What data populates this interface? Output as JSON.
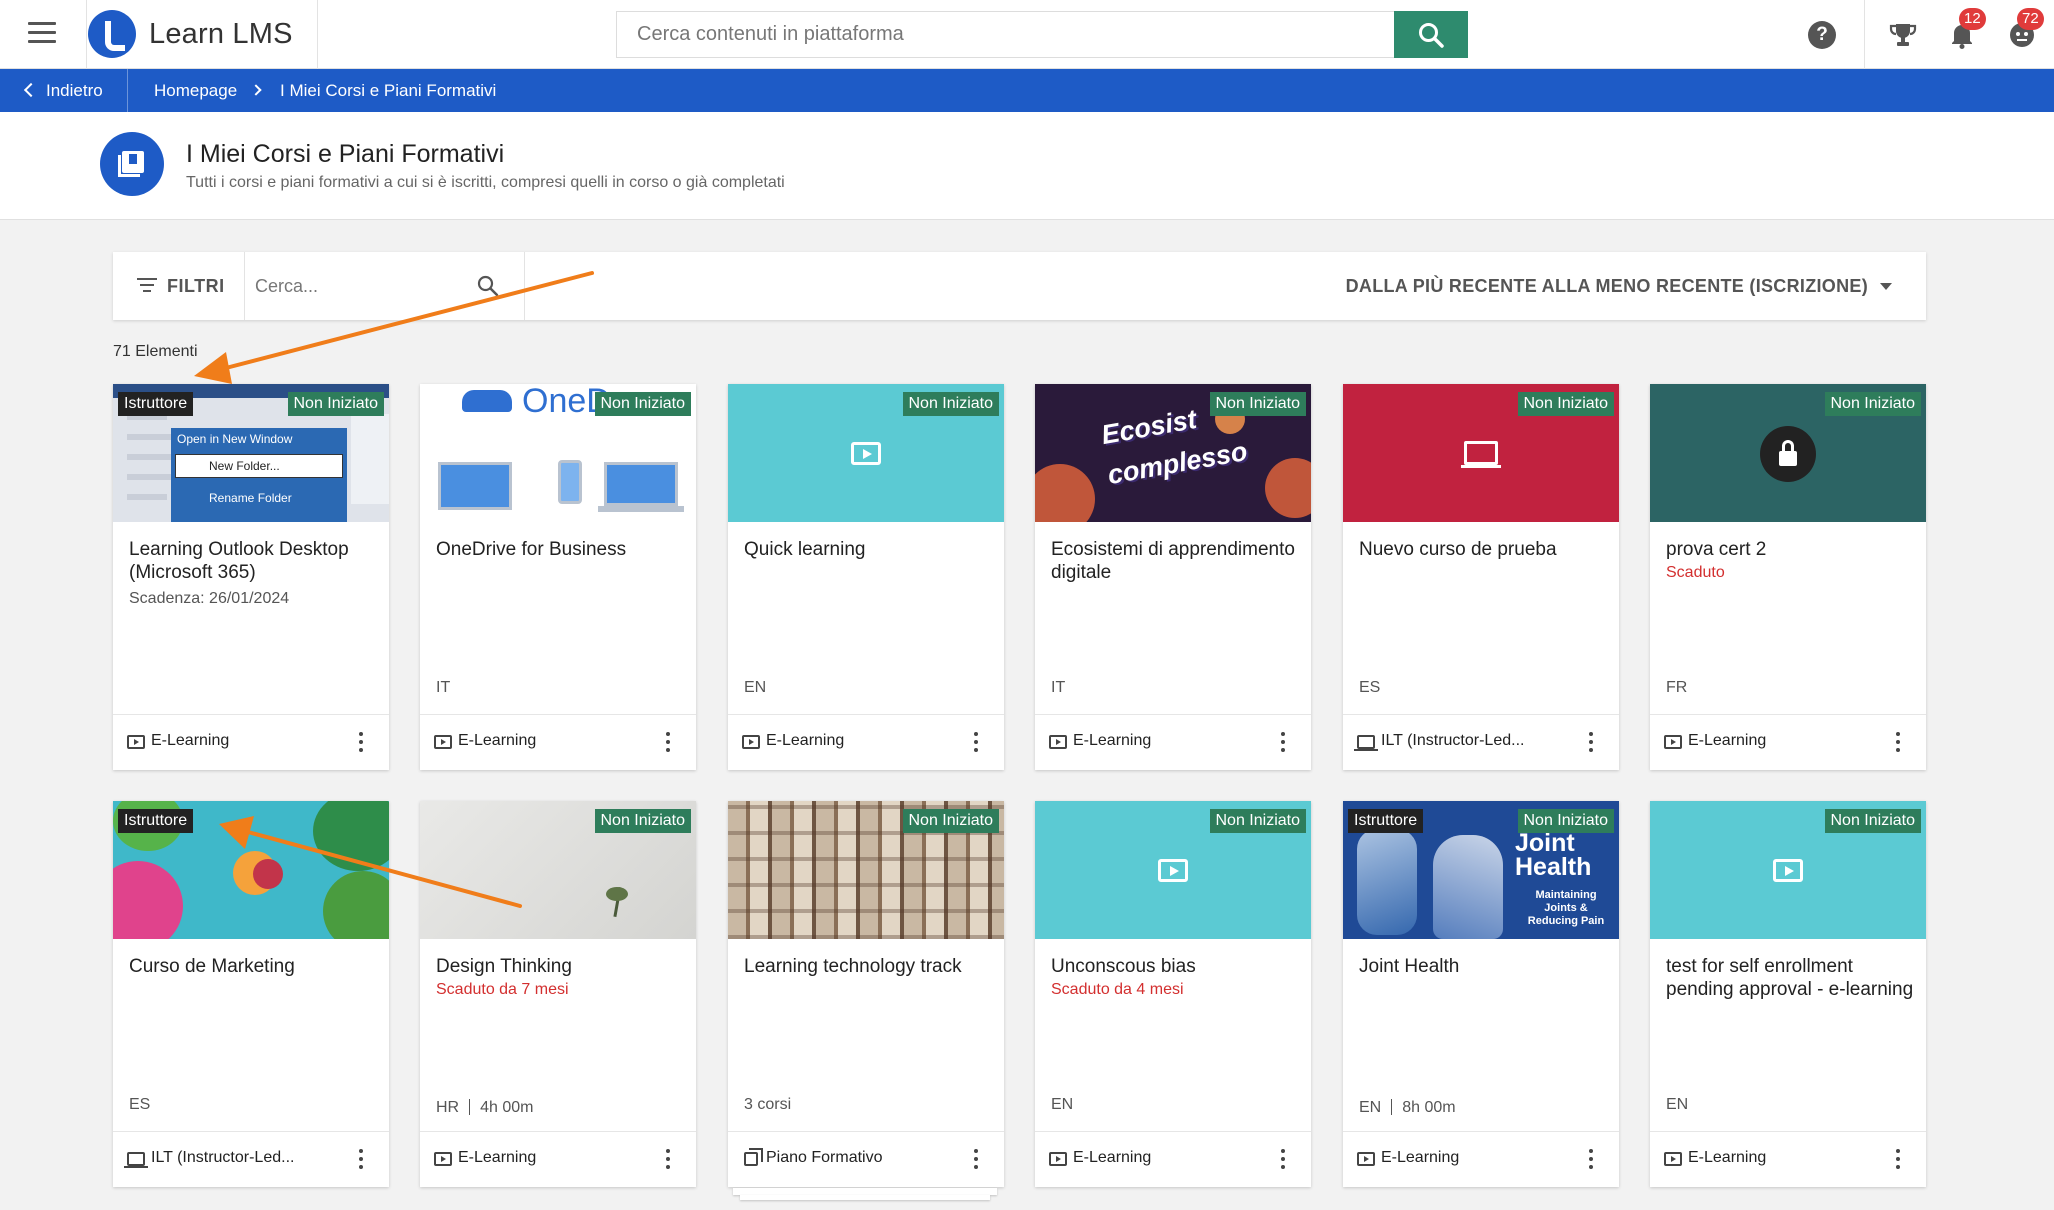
{
  "app": {
    "name": "Learn LMS",
    "search_placeholder": "Cerca contenuti in piattaforma",
    "notifications_count": "12",
    "messages_count": "72"
  },
  "breadcrumb": {
    "back_label": "Indietro",
    "home_label": "Homepage",
    "current_label": "I Miei Corsi e Piani Formativi"
  },
  "page": {
    "title": "I Miei Corsi e Piani Formativi",
    "subtitle": "Tutti i corsi e piani formativi a cui si è iscritti, compresi quelli in corso o già completati"
  },
  "filters": {
    "filter_label": "FILTRI",
    "search_placeholder": "Cerca...",
    "sort_label": "DALLA PIÙ RECENTE ALLA MENO RECENTE (ISCRIZIONE)"
  },
  "items_count": "71 Elementi",
  "thumb_texts": {
    "menu_open": "Open in New Window",
    "menu_new": "New Folder...",
    "menu_rename": "Rename Folder",
    "onedrive": "OneD",
    "ecosistemi_1": "Ecosist",
    "ecosistemi_2": "complesso",
    "joint_1": "Joint",
    "joint_2": "Health",
    "joint_3": "Maintaining",
    "joint_4": "Joints &",
    "joint_5": "Reducing Pain"
  },
  "courses": [
    {
      "title": "Learning Outlook Desktop (Microsoft 365)",
      "status": "Non Iniziato",
      "instructor_tag": "Istruttore",
      "sub": "Scadenza: 26/01/2024",
      "lang": "",
      "type": "E-Learning"
    },
    {
      "title": "OneDrive for Business",
      "status": "Non Iniziato",
      "lang": "IT",
      "type": "E-Learning"
    },
    {
      "title": "Quick learning",
      "status": "Non Iniziato",
      "lang": "EN",
      "type": "E-Learning"
    },
    {
      "title": "Ecosistemi di apprendimento digitale",
      "status": "Non Iniziato",
      "lang": "IT",
      "type": "E-Learning"
    },
    {
      "title": "Nuevo curso de prueba",
      "status": "Non Iniziato",
      "lang": "ES",
      "type": "ILT (Instructor-Led..."
    },
    {
      "title": "prova cert 2",
      "status": "Non Iniziato",
      "sub": "Scaduto",
      "lang": "FR",
      "type": "E-Learning"
    },
    {
      "title": "Curso de Marketing",
      "instructor_tag": "Istruttore",
      "lang": "ES",
      "type": "ILT (Instructor-Led..."
    },
    {
      "title": "Design Thinking",
      "status": "Non Iniziato",
      "sub": "Scaduto da 7 mesi",
      "lang": "HR",
      "duration": "4h 00m",
      "type": "E-Learning"
    },
    {
      "title": "Learning technology track",
      "status": "Non Iniziato",
      "lang": "3 corsi",
      "type": "Piano Formativo"
    },
    {
      "title": "Unconscous bias",
      "status": "Non Iniziato",
      "sub": "Scaduto da 4 mesi",
      "lang": "EN",
      "type": "E-Learning"
    },
    {
      "title": "Joint Health",
      "status": "Non Iniziato",
      "instructor_tag": "Istruttore",
      "lang": "EN",
      "duration": "8h 00m",
      "type": "E-Learning"
    },
    {
      "title": "test for self enrollment pending approval - e-learning",
      "status": "Non Iniziato",
      "lang": "EN",
      "type": "E-Learning"
    }
  ],
  "colors": {
    "brand_blue": "#1e5bc6",
    "search_green": "#2e8b6e",
    "status_green": "#2e7d5b",
    "teal_thumb": "#5bcad3",
    "crimson_thumb": "#c1223f",
    "dark_teal_thumb": "#2c6464",
    "expired_red": "#d32f2f",
    "annotation_arrow": "#f07d1a"
  }
}
